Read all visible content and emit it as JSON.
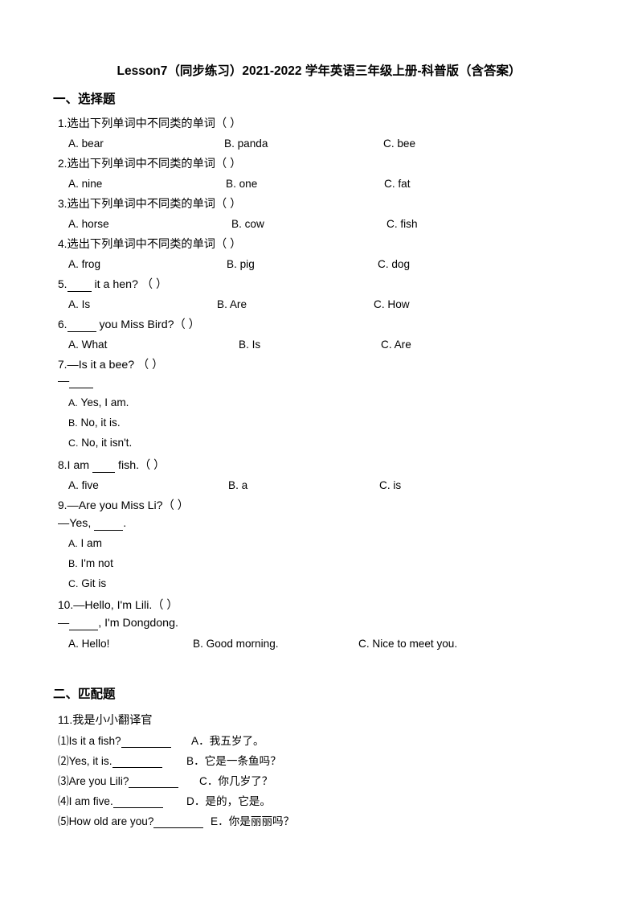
{
  "document": {
    "title": "Lesson7（同步练习）2021-2022 学年英语三年级上册-科普版（含答案）"
  },
  "sections": [
    {
      "heading": "一、选择题",
      "questions": [
        {
          "number": "1.",
          "stem": "选出下列单词中不同类的单词（       ）",
          "layout": "horizontal",
          "options": [
            {
              "label": "A. bear"
            },
            {
              "label": "B. panda"
            },
            {
              "label": "C. bee"
            }
          ]
        },
        {
          "number": "2.",
          "stem": "选出下列单词中不同类的单词（       ）",
          "layout": "horizontal",
          "options": [
            {
              "label": "A. nine"
            },
            {
              "label": "B. one"
            },
            {
              "label": "C. fat"
            }
          ]
        },
        {
          "number": "3.",
          "stem": "选出下列单词中不同类的单词（       ）",
          "layout": "horizontal",
          "options": [
            {
              "label": "A. horse"
            },
            {
              "label": "B. cow"
            },
            {
              "label": "C. fish"
            }
          ]
        },
        {
          "number": "4.",
          "stem": "选出下列单词中不同类的单词（       ）",
          "layout": "horizontal",
          "options": [
            {
              "label": "A. frog"
            },
            {
              "label": "B. pig"
            },
            {
              "label": "C. dog"
            }
          ]
        },
        {
          "number": "5.",
          "stem_before_blank": "",
          "stem_after_blank": " it a hen?  （       ）",
          "layout": "horizontal",
          "options": [
            {
              "label": "A. Is"
            },
            {
              "label": "B. Are"
            },
            {
              "label": "C. How"
            }
          ]
        },
        {
          "number": "6.",
          "stem_before_blank": "",
          "stem_after_blank": " you Miss Bird?（       ）",
          "layout": "horizontal",
          "options": [
            {
              "label": "A. What"
            },
            {
              "label": "B. Is"
            },
            {
              "label": "C. Are"
            }
          ]
        },
        {
          "number": "7.",
          "stem": "—Is it a bee?  （       ）",
          "answer_line_prefix": "—",
          "layout": "vertical",
          "options": [
            {
              "letter": "A.",
              "text": "Yes, I am."
            },
            {
              "letter": "B.",
              "text": "No, it is."
            },
            {
              "letter": "C.",
              "text": "No, it isn't."
            }
          ]
        },
        {
          "number": "8.",
          "stem_before_blank": "I am ",
          "stem_after_blank": " fish.（       ）",
          "layout": "horizontal",
          "options": [
            {
              "label": "A. five"
            },
            {
              "label": "B. a"
            },
            {
              "label": "C. is"
            }
          ]
        },
        {
          "number": "9.",
          "stem": "—Are you Miss Li?（       ）",
          "answer_line_prefix": "—Yes, ",
          "answer_line_suffix": ".",
          "layout": "vertical",
          "options": [
            {
              "letter": "A.",
              "text": "I am"
            },
            {
              "letter": "B.",
              "text": "I'm not"
            },
            {
              "letter": "C.",
              "text": "Git is"
            }
          ]
        },
        {
          "number": "10.",
          "stem": "—Hello, I'm Lili.（       ）",
          "answer_line_prefix": "—",
          "answer_line_suffix": ", I'm Dongdong.",
          "layout": "horizontal",
          "options": [
            {
              "label": "A. Hello!"
            },
            {
              "label": "B. Good morning."
            },
            {
              "label": "C. Nice to meet you."
            }
          ]
        }
      ]
    },
    {
      "heading": "二、匹配题",
      "matching": {
        "number": "11.",
        "prompt": "我是小小翻译官",
        "left_items": [
          {
            "marker": "⑴",
            "text": "Is it a fish?"
          },
          {
            "marker": "⑵",
            "text": "Yes, it is."
          },
          {
            "marker": "⑶",
            "text": "Are you Lili?"
          },
          {
            "marker": "⑷",
            "text": "I am five."
          },
          {
            "marker": "⑸",
            "text": "How old are you?"
          }
        ],
        "right_items": [
          {
            "letter": "A．",
            "text": "我五岁了。"
          },
          {
            "letter": "B．",
            "text": "它是一条鱼吗？"
          },
          {
            "letter": "C．",
            "text": "你几岁了？"
          },
          {
            "letter": "D．",
            "text": "是的，它是。"
          },
          {
            "letter": "E．",
            "text": "你是丽丽吗？"
          }
        ]
      }
    }
  ]
}
